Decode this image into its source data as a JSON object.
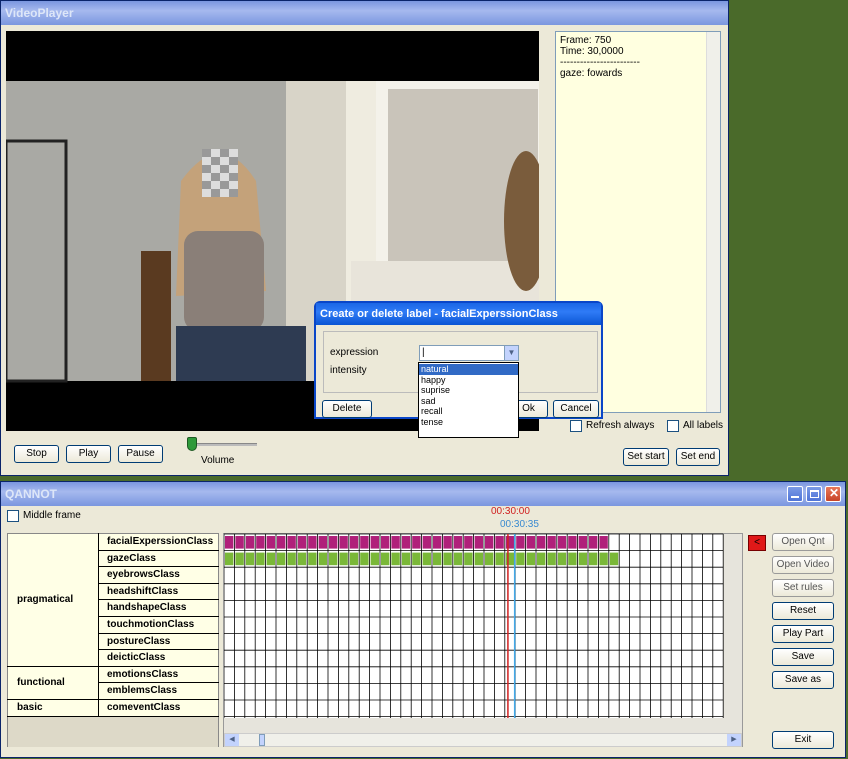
{
  "video_window": {
    "title": "VideoPlayer",
    "info_lines": [
      "Frame: 750",
      "Time: 30,0000",
      "------------------------",
      "gaze: fowards"
    ],
    "buttons": {
      "stop": "Stop",
      "play": "Play",
      "pause": "Pause",
      "set_start": "Set start",
      "set_end": "Set end"
    },
    "volume_label": "Volume",
    "refresh_always": "Refresh always",
    "all_labels": "All labels"
  },
  "dialog": {
    "title": "Create or delete label  -  facialExperssionClass",
    "expression_label": "expression",
    "intensity_label": "intensity",
    "expression_value": "",
    "options": [
      "natural",
      "happy",
      "suprise",
      "sad",
      "recall",
      "tense"
    ],
    "highlighted_option": "natural",
    "delete": "Delete",
    "ok": "Ok",
    "cancel": "Cancel"
  },
  "qannot": {
    "title": "QANNOT",
    "middle_frame": "Middle frame",
    "time_red": "00:30:00",
    "time_blue": "00:30:35",
    "groups": [
      {
        "name": "pragmatical",
        "classes": [
          "facialExperssionClass",
          "gazeClass",
          "eyebrowsClass",
          "headshiftClass",
          "handshapeClass",
          "touchmotionClass",
          "postureClass",
          "deicticClass"
        ]
      },
      {
        "name": "functional",
        "classes": [
          "emotionsClass",
          "emblemsClass"
        ]
      },
      {
        "name": "basic",
        "classes": [
          "comeventClass"
        ]
      }
    ],
    "filled_cells": {
      "facialExperssionClass": 37,
      "gazeClass": 38
    },
    "buttons": [
      "Open Qnt",
      "Open Video",
      "Set rules",
      "Reset",
      "Play Part",
      "Save",
      "Save as"
    ],
    "exit": "Exit",
    "marker_button": "<"
  },
  "colors": {
    "magenta": "#b0207a",
    "green": "#7ab838",
    "red_line": "#d02020",
    "blue_line": "#40a8e8"
  }
}
